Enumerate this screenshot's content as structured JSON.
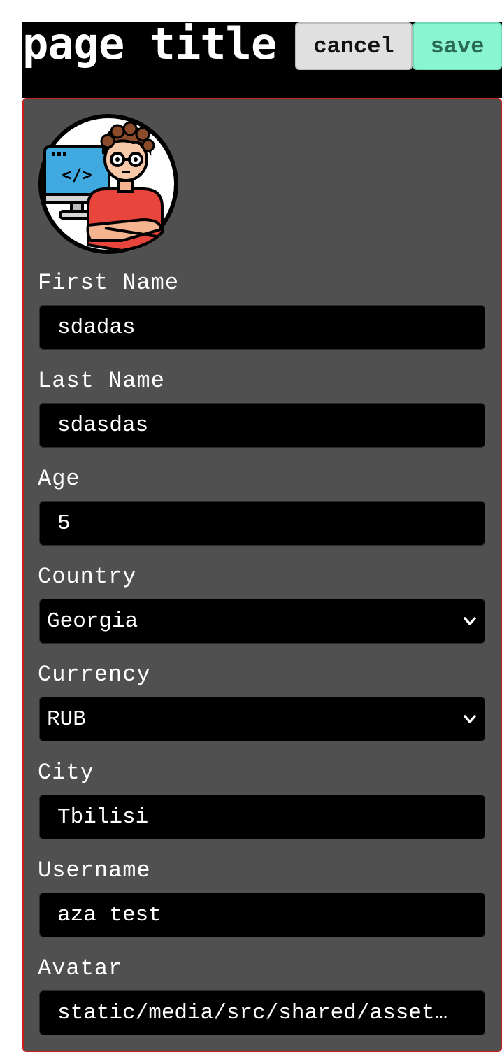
{
  "header": {
    "title": "page title",
    "cancel_label": "cancel",
    "save_label": "save"
  },
  "colors": {
    "card_background": "#505050",
    "card_border": "#c81e1e",
    "save_button": "#8af5d1",
    "cancel_button": "#e0e0e0",
    "input_background": "#000000"
  },
  "avatar": {
    "icon": "developer-avatar-icon"
  },
  "fields": [
    {
      "label": "First Name",
      "value": "sdadas",
      "type": "text"
    },
    {
      "label": "Last Name",
      "value": "sdasdas",
      "type": "text"
    },
    {
      "label": "Age",
      "value": "5",
      "type": "number"
    },
    {
      "label": "Country",
      "value": "Georgia",
      "type": "select"
    },
    {
      "label": "Currency",
      "value": "RUB",
      "type": "select"
    },
    {
      "label": "City",
      "value": "Tbilisi",
      "type": "text"
    },
    {
      "label": "Username",
      "value": "aza test",
      "type": "text"
    },
    {
      "label": "Avatar",
      "value": "static/media/src/shared/asset…",
      "type": "text"
    }
  ]
}
